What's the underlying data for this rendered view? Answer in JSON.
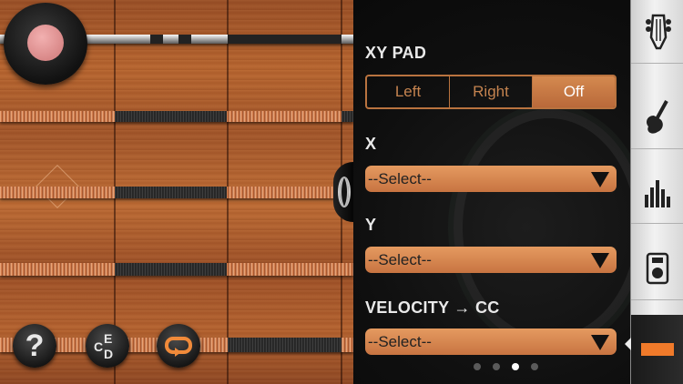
{
  "panel": {
    "xy_pad": {
      "title": "XY PAD",
      "options": [
        "Left",
        "Right",
        "Off"
      ],
      "selected": "Off"
    },
    "x": {
      "label": "X",
      "value": "--Select--"
    },
    "y": {
      "label": "Y",
      "value": "--Select--"
    },
    "velocity_cc": {
      "label": "VELOCITY → CC",
      "value": "--Select--"
    },
    "page_dots": {
      "count": 4,
      "current_index": 2
    }
  },
  "fretboard": {
    "buttons": {
      "help_label": "?",
      "chord_letters": [
        "C",
        "E",
        "D"
      ],
      "loop_icon": "loop-icon"
    }
  },
  "sidebar": {
    "items": [
      {
        "icon": "guitar-headstock-icon"
      },
      {
        "icon": "guitar-body-icon"
      },
      {
        "icon": "equalizer-icon"
      },
      {
        "icon": "amplifier-icon"
      },
      {
        "icon": "settings-slider-icon"
      }
    ],
    "active_index": 4
  },
  "colors": {
    "accent": "#c87441",
    "active_segment": "#d4894f",
    "panel_bg": "#0f0f0f"
  }
}
